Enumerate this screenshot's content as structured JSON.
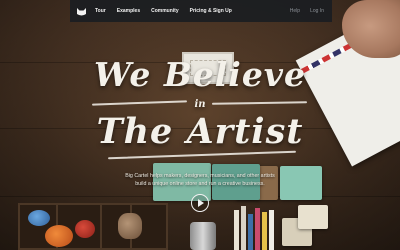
{
  "nav": {
    "logo_icon": "cat-logo-icon",
    "items": [
      {
        "label": "Tour"
      },
      {
        "label": "Examples"
      },
      {
        "label": "Community"
      },
      {
        "label": "Pricing & Sign Up"
      }
    ],
    "right_items": [
      {
        "label": "Help"
      },
      {
        "label": "Log In"
      }
    ]
  },
  "hero": {
    "line1": "We Believe",
    "line2": "in",
    "line3": "The Artist",
    "tagline_1": "Big Cartel helps makers, designers, musicians, and other artists",
    "tagline_2": "build a unique online store and run a creative business.",
    "play_icon": "play-icon"
  },
  "colors": {
    "nav_bg": "#1c1e21",
    "nav_text": "#f2f2f2",
    "nav_muted": "#8b9096",
    "hero_text": "#f4f1ea"
  }
}
